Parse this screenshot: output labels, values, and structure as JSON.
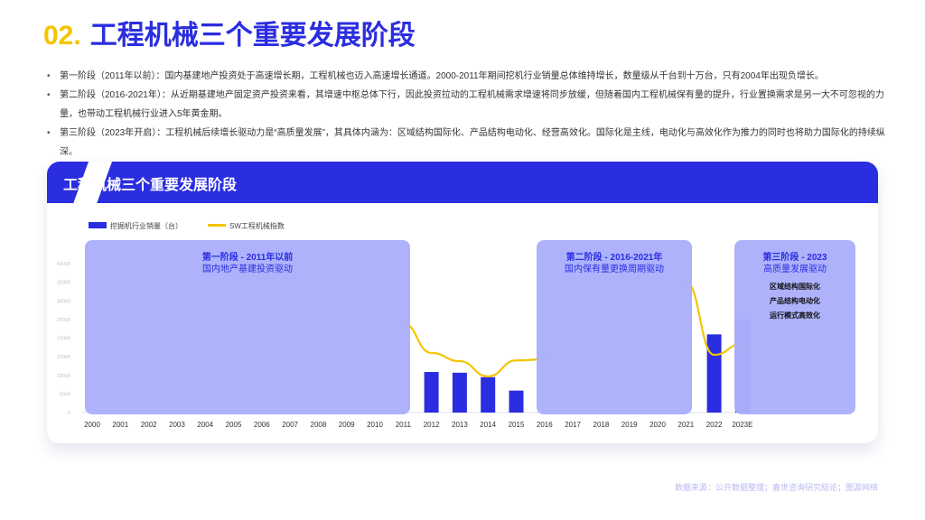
{
  "heading": {
    "number": "02.",
    "text": "工程机械三个重要发展阶段"
  },
  "bullets": [
    "第一阶段（2011年以前）：国内基建地产投资处于高速增长期，工程机械也迈入高速增长通道。2000-2011年期间挖机行业销量总体维持增长，数量级从千台到十万台，只有2004年出现负增长。",
    "第二阶段（2016-2021年）：从近期基建地产固定资产投资来看，其增速中枢总体下行，因此投资拉动的工程机械需求增速将同步放缓，但随着国内工程机械保有量的提升，行业置换需求是另一大不可忽视的力量，也带动工程机械行业进入5年黄金期。",
    "第三阶段（2023年开启）：工程机械后续增长驱动力是“高质量发展”，其具体内涵为：区域结构国际化、产品结构电动化、经营高效化。国际化是主线，电动化与高效化作为推力的同时也将助力国际化的持续纵深。"
  ],
  "card": {
    "title": "工程机械三个重要发展阶段"
  },
  "colors": {
    "primary": "#2b2de0",
    "accent": "#f5c400",
    "panel": "#aab0fb"
  },
  "chart_data": {
    "type": "bar",
    "legend": [
      "挖掘机行业销量（台）",
      "SW工程机械指数"
    ],
    "legend_position": "top-left",
    "categories": [
      "2000",
      "2001",
      "2002",
      "2003",
      "2004",
      "2005",
      "2006",
      "2007",
      "2008",
      "2009",
      "2010",
      "2011",
      "2012",
      "2013",
      "2014",
      "2015",
      "2016",
      "2017",
      "2018",
      "2019",
      "2020",
      "2021",
      "2022",
      "2023E"
    ],
    "series": [
      {
        "name": "挖掘机行业销量（台）",
        "type": "bar",
        "values": [
          null,
          null,
          null,
          null,
          null,
          null,
          null,
          null,
          null,
          null,
          null,
          null,
          10900,
          10700,
          9500,
          5900,
          null,
          null,
          null,
          null,
          null,
          null,
          21000,
          25000
        ]
      },
      {
        "name": "SW工程机械指数",
        "type": "line",
        "values": [
          null,
          null,
          null,
          null,
          null,
          null,
          null,
          null,
          null,
          null,
          null,
          24000,
          16000,
          13800,
          9700,
          14000,
          14300,
          null,
          null,
          null,
          null,
          35000,
          15500,
          18500
        ]
      }
    ],
    "yticks": [
      0,
      5000,
      10000,
      15000,
      20000,
      25000,
      30000,
      35000,
      40000
    ],
    "ylim": [
      0,
      40000
    ],
    "annotations": [
      {
        "title": "第一阶段 - 2011年以前",
        "subtitle": "国内地产基建投资驱动",
        "items": [],
        "span": [
          "2000",
          "2011"
        ]
      },
      {
        "title": "第二阶段 - 2016-2021年",
        "subtitle": "国内保有量更换周期驱动",
        "items": [],
        "span": [
          "2016",
          "2021"
        ]
      },
      {
        "title": "第三阶段 - 2023",
        "subtitle": "高质量发展驱动",
        "items": [
          "区域结构国际化",
          "产品结构电动化",
          "运行模式高效化"
        ],
        "span": [
          "2023E",
          "2023E"
        ]
      }
    ]
  },
  "source": "数据来源：公开数据整理；嘉世咨询研究结论；图源网络"
}
